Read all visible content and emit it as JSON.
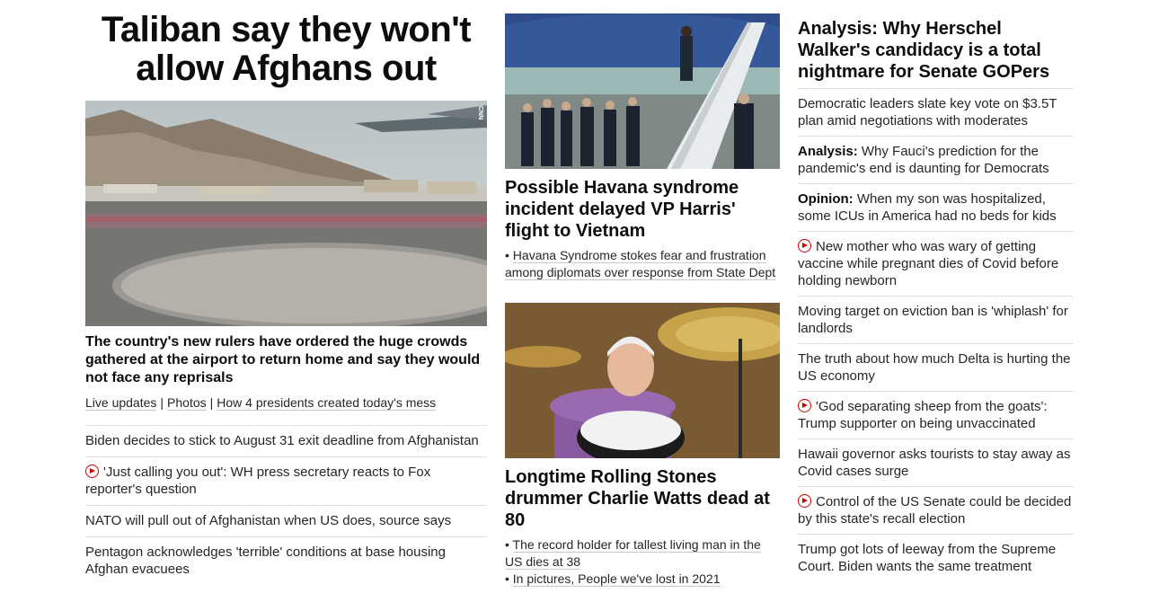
{
  "left": {
    "headline": "Taliban say they won't allow Afghans out",
    "image_tag": "CNN",
    "subhead": "The country's new rulers have ordered the huge crowds gathered at the airport to return home and say they would not face any reprisals",
    "links": [
      "Live updates",
      "Photos",
      "How 4 presidents created today's mess"
    ],
    "separator": "|",
    "items": [
      {
        "text": "Biden decides to stick to August 31 exit deadline from Afghanistan",
        "video": false
      },
      {
        "text": "'Just calling you out': WH press secretary reacts to Fox reporter's question",
        "video": true
      },
      {
        "text": "NATO will pull out of Afghanistan when US does, source says",
        "video": false
      },
      {
        "text": "Pentagon acknowledges 'terrible' conditions at base housing Afghan evacuees",
        "video": false
      }
    ]
  },
  "middle": {
    "card1": {
      "title": "Possible Havana syndrome incident delayed VP Harris' flight to Vietnam",
      "bullets": [
        "Havana Syndrome stokes fear and frustration among diplomats over response from State Dept"
      ]
    },
    "card2": {
      "title": "Longtime Rolling Stones drummer Charlie Watts dead at 80",
      "bullets": [
        "The record holder for tallest living man in the US dies at 38",
        "In pictures, People we've lost in 2021"
      ]
    },
    "bullet_mark": "•"
  },
  "right": {
    "title": "Analysis: Why Herschel Walker's candidacy is a total nightmare for Senate GOPers",
    "items": [
      {
        "prefix": "",
        "text": "Democratic leaders slate key vote on $3.5T plan amid negotiations with moderates",
        "video": false
      },
      {
        "prefix": "Analysis:",
        "text": " Why Fauci's prediction for the pandemic's end is daunting for Democrats",
        "video": false
      },
      {
        "prefix": "Opinion:",
        "text": " When my son was hospitalized, some ICUs in America had no beds for kids",
        "video": false
      },
      {
        "prefix": "",
        "text": "New mother who was wary of getting vaccine while pregnant dies of Covid before holding newborn",
        "video": true
      },
      {
        "prefix": "",
        "text": "Moving target on eviction ban is 'whiplash' for landlords",
        "video": false
      },
      {
        "prefix": "",
        "text": "The truth about how much Delta is hurting the US economy",
        "video": false
      },
      {
        "prefix": "",
        "text": "'God separating sheep from the goats': Trump supporter on being unvaccinated",
        "video": true
      },
      {
        "prefix": "",
        "text": "Hawaii governor asks tourists to stay away as Covid cases surge",
        "video": false
      },
      {
        "prefix": "",
        "text": "Control of the US Senate could be decided by this state's recall election",
        "video": true
      },
      {
        "prefix": "",
        "text": "Trump got lots of leeway from the Supreme Court. Biden wants the same treatment",
        "video": false
      }
    ]
  },
  "colors": {
    "video_red": "#cc0000",
    "text": "#262626",
    "divider": "#e0e0e0"
  }
}
